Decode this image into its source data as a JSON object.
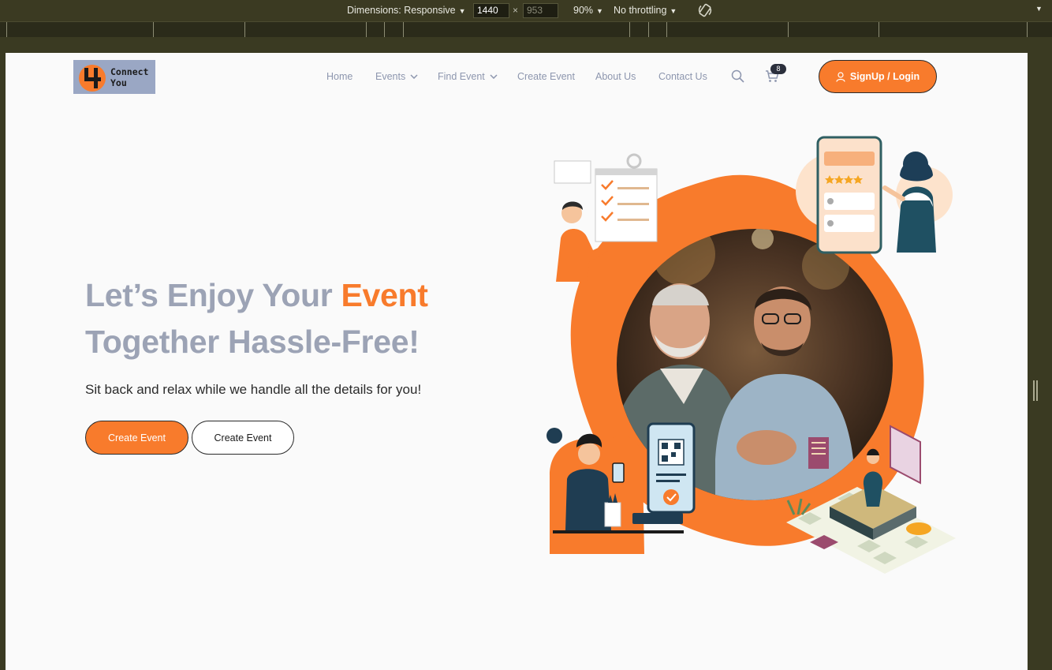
{
  "devtools": {
    "dimensions_label": "Dimensions: Responsive",
    "width": "1440",
    "height": "953",
    "times": "×",
    "zoom": "90%",
    "throttling": "No throttling"
  },
  "header": {
    "logo_line1": "Connect",
    "logo_line2": "You",
    "nav": [
      {
        "label": "Home"
      },
      {
        "label": "Events"
      },
      {
        "label": "Find Event"
      },
      {
        "label": "Create Event"
      },
      {
        "label": "About Us"
      },
      {
        "label": "Contact Us"
      }
    ],
    "cart_count": "8",
    "signup_label": "SignUp / Login"
  },
  "hero": {
    "title_part1": "Let’s Enjoy Your ",
    "title_accent": "Event",
    "title_part2": "Together Hassle-Free!",
    "subtitle": "Sit back and relax while we handle all the details for you!",
    "primary_button": "Create Event",
    "secondary_button": "Create Event"
  },
  "colors": {
    "accent": "#f87b2c",
    "title_gray": "#9ca3b5",
    "nav_text": "#8d96ae",
    "devtools_bg": "#3b3a22"
  },
  "icons": [
    "search-icon",
    "cart-icon",
    "user-icon",
    "chevron-down-icon",
    "rotate-icon",
    "more-options-icon"
  ]
}
